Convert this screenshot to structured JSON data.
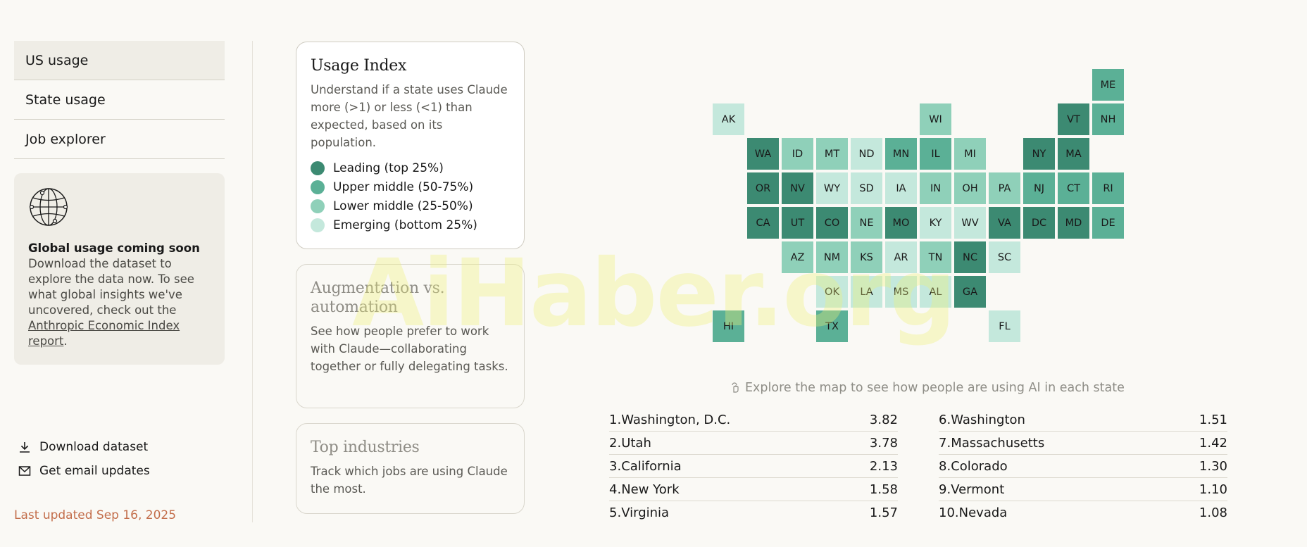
{
  "sidebar": {
    "nav": [
      "US usage",
      "State usage",
      "Job explorer"
    ],
    "global_title": "Global usage coming soon",
    "global_body": "Download the dataset to explore the data now. To see what global insights we've uncovered, check out the ",
    "global_link": "Anthropic Economic Index report",
    "global_tail": ".",
    "download_label": "Download dataset",
    "email_label": "Get email updates",
    "last_updated": "Last updated Sep 16, 2025"
  },
  "cards": {
    "usage_index": {
      "title": "Usage Index",
      "body": "Understand if a state uses Claude more (>1) or less (<1) than expected, based on its population.",
      "legend": [
        {
          "label": "Leading (top 25%)",
          "color": "#3c8a72"
        },
        {
          "label": "Upper middle (50-75%)",
          "color": "#5bb096"
        },
        {
          "label": "Lower middle (25-50%)",
          "color": "#8fd0b9"
        },
        {
          "label": "Emerging (bottom 25%)",
          "color": "#c4e8dc"
        }
      ]
    },
    "augmentation": {
      "title": "Augmentation vs. automation",
      "body": "See how people prefer to work with Claude—collaborating together or fully delegating tasks."
    },
    "industries": {
      "title": "Top industries",
      "body": "Track which jobs are using Claude the most."
    }
  },
  "map": {
    "hint": "Explore the map to see how people are using AI in each state",
    "colors": {
      "1": "#3c8a72",
      "2": "#5bb096",
      "3": "#8fd0b9",
      "4": "#c4e8dc"
    },
    "tiles": [
      {
        "s": "ME",
        "c": 11,
        "r": 0,
        "t": 2
      },
      {
        "s": "AK",
        "c": 0,
        "r": 1,
        "t": 4
      },
      {
        "s": "WI",
        "c": 6,
        "r": 1,
        "t": 3
      },
      {
        "s": "VT",
        "c": 10,
        "r": 1,
        "t": 1
      },
      {
        "s": "NH",
        "c": 11,
        "r": 1,
        "t": 2
      },
      {
        "s": "WA",
        "c": 1,
        "r": 2,
        "t": 1
      },
      {
        "s": "ID",
        "c": 2,
        "r": 2,
        "t": 3
      },
      {
        "s": "MT",
        "c": 3,
        "r": 2,
        "t": 3
      },
      {
        "s": "ND",
        "c": 4,
        "r": 2,
        "t": 4
      },
      {
        "s": "MN",
        "c": 5,
        "r": 2,
        "t": 2
      },
      {
        "s": "IL",
        "c": 6,
        "r": 2,
        "t": 2
      },
      {
        "s": "MI",
        "c": 7,
        "r": 2,
        "t": 3
      },
      {
        "s": "NY",
        "c": 9,
        "r": 2,
        "t": 1
      },
      {
        "s": "MA",
        "c": 10,
        "r": 2,
        "t": 1
      },
      {
        "s": "OR",
        "c": 1,
        "r": 3,
        "t": 1
      },
      {
        "s": "NV",
        "c": 2,
        "r": 3,
        "t": 1
      },
      {
        "s": "WY",
        "c": 3,
        "r": 3,
        "t": 4
      },
      {
        "s": "SD",
        "c": 4,
        "r": 3,
        "t": 4
      },
      {
        "s": "IA",
        "c": 5,
        "r": 3,
        "t": 4
      },
      {
        "s": "IN",
        "c": 6,
        "r": 3,
        "t": 3
      },
      {
        "s": "OH",
        "c": 7,
        "r": 3,
        "t": 3
      },
      {
        "s": "PA",
        "c": 8,
        "r": 3,
        "t": 3
      },
      {
        "s": "NJ",
        "c": 9,
        "r": 3,
        "t": 2
      },
      {
        "s": "CT",
        "c": 10,
        "r": 3,
        "t": 2
      },
      {
        "s": "RI",
        "c": 11,
        "r": 3,
        "t": 2
      },
      {
        "s": "CA",
        "c": 1,
        "r": 4,
        "t": 1
      },
      {
        "s": "UT",
        "c": 2,
        "r": 4,
        "t": 1
      },
      {
        "s": "CO",
        "c": 3,
        "r": 4,
        "t": 1
      },
      {
        "s": "NE",
        "c": 4,
        "r": 4,
        "t": 3
      },
      {
        "s": "MO",
        "c": 5,
        "r": 4,
        "t": 1
      },
      {
        "s": "KY",
        "c": 6,
        "r": 4,
        "t": 4
      },
      {
        "s": "WV",
        "c": 7,
        "r": 4,
        "t": 4
      },
      {
        "s": "VA",
        "c": 8,
        "r": 4,
        "t": 1
      },
      {
        "s": "DC",
        "c": 9,
        "r": 4,
        "t": 1
      },
      {
        "s": "MD",
        "c": 10,
        "r": 4,
        "t": 1
      },
      {
        "s": "DE",
        "c": 11,
        "r": 4,
        "t": 2
      },
      {
        "s": "AZ",
        "c": 2,
        "r": 5,
        "t": 3
      },
      {
        "s": "NM",
        "c": 3,
        "r": 5,
        "t": 3
      },
      {
        "s": "KS",
        "c": 4,
        "r": 5,
        "t": 3
      },
      {
        "s": "AR",
        "c": 5,
        "r": 5,
        "t": 4
      },
      {
        "s": "TN",
        "c": 6,
        "r": 5,
        "t": 3
      },
      {
        "s": "NC",
        "c": 7,
        "r": 5,
        "t": 1
      },
      {
        "s": "SC",
        "c": 8,
        "r": 5,
        "t": 4
      },
      {
        "s": "OK",
        "c": 3,
        "r": 6,
        "t": 4
      },
      {
        "s": "LA",
        "c": 4,
        "r": 6,
        "t": 4
      },
      {
        "s": "MS",
        "c": 5,
        "r": 6,
        "t": 4
      },
      {
        "s": "AL",
        "c": 6,
        "r": 6,
        "t": 4
      },
      {
        "s": "GA",
        "c": 7,
        "r": 6,
        "t": 1
      },
      {
        "s": "HI",
        "c": 0,
        "r": 7,
        "t": 2
      },
      {
        "s": "TX",
        "c": 3,
        "r": 7,
        "t": 2
      },
      {
        "s": "FL",
        "c": 8,
        "r": 7,
        "t": 4
      }
    ]
  },
  "rankings": {
    "left": [
      {
        "rank": "1.",
        "name": "Washington, D.C.",
        "value": "3.82"
      },
      {
        "rank": "2.",
        "name": "Utah",
        "value": "3.78"
      },
      {
        "rank": "3.",
        "name": "California",
        "value": "2.13"
      },
      {
        "rank": "4.",
        "name": "New York",
        "value": "1.58"
      },
      {
        "rank": "5.",
        "name": "Virginia",
        "value": "1.57"
      }
    ],
    "right": [
      {
        "rank": "6.",
        "name": "Washington",
        "value": "1.51"
      },
      {
        "rank": "7.",
        "name": "Massachusetts",
        "value": "1.42"
      },
      {
        "rank": "8.",
        "name": "Colorado",
        "value": "1.30"
      },
      {
        "rank": "9.",
        "name": "Vermont",
        "value": "1.10"
      },
      {
        "rank": "10.",
        "name": "Nevada",
        "value": "1.08"
      }
    ]
  },
  "watermark": "AiHaber.org"
}
